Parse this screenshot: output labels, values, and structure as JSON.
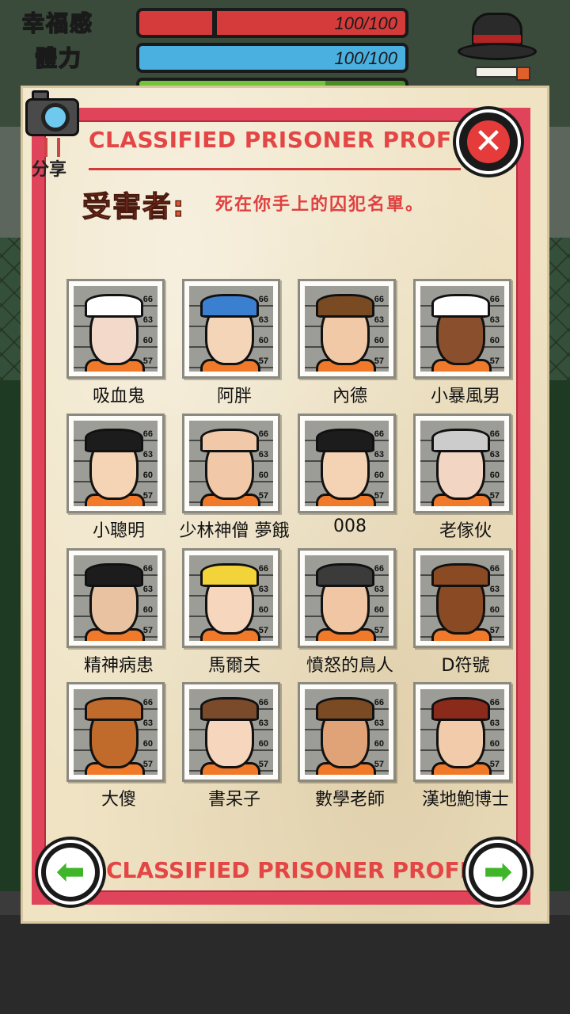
{
  "hud": {
    "happiness_label": "幸福感",
    "happiness_value": "100/100",
    "happiness_fraction": 1.0,
    "stamina_label": "體力",
    "stamina_value": "100/100",
    "stamina_fraction": 1.0
  },
  "dialog": {
    "title_top": "CLASSIFIED PRISONER PROFILE",
    "title_bottom": "CLASSIFIED PRISONER PROFILE",
    "victims_label": "受害者:",
    "victims_desc": "死在你手上的囚犯名單。",
    "share_label": "分享",
    "close_icon": "close-icon",
    "prev_icon": "arrow-left-icon",
    "next_icon": "arrow-right-icon"
  },
  "mugshot_scale": [
    "66",
    "63",
    "60",
    "57"
  ],
  "prisoners": [
    {
      "name": "吸血鬼",
      "skin": "#f2d9c9",
      "hair": "#ffffff"
    },
    {
      "name": "阿胖",
      "skin": "#f5d5b8",
      "hair": "#3a7fd0"
    },
    {
      "name": "內德",
      "skin": "#f1c9a6",
      "hair": "#7a4a22"
    },
    {
      "name": "小暴風男",
      "skin": "#8a4f2c",
      "hair": "#ffffff"
    },
    {
      "name": "小聰明",
      "skin": "#f5d4b6",
      "hair": "#1c1c1c"
    },
    {
      "name": "少林神僧 夢餓",
      "skin": "#f2c9a8",
      "hair": "#f2c9a8"
    },
    {
      "name": "008",
      "skin": "#f4d2b4",
      "hair": "#1c1c1c"
    },
    {
      "name": "老傢伙",
      "skin": "#f2d5c2",
      "hair": "#cccccc"
    },
    {
      "name": "精神病患",
      "skin": "#e9c2a2",
      "hair": "#1c1c1c"
    },
    {
      "name": "馬爾夫",
      "skin": "#f6d6bd",
      "hair": "#f3d33a"
    },
    {
      "name": "憤怒的鳥人",
      "skin": "#f0c6a4",
      "hair": "#3b3b3b"
    },
    {
      "name": "D符號",
      "skin": "#8a4a24",
      "hair": "#8a4a24"
    },
    {
      "name": "大傻",
      "skin": "#c06a2c",
      "hair": "#c06a2c"
    },
    {
      "name": "書呆子",
      "skin": "#f6d6bd",
      "hair": "#7a4a2a"
    },
    {
      "name": "數學老師",
      "skin": "#e0a277",
      "hair": "#7a4a22"
    },
    {
      "name": "漢地鮑博士",
      "skin": "#f2cbaa",
      "hair": "#8a2a1a"
    }
  ]
}
